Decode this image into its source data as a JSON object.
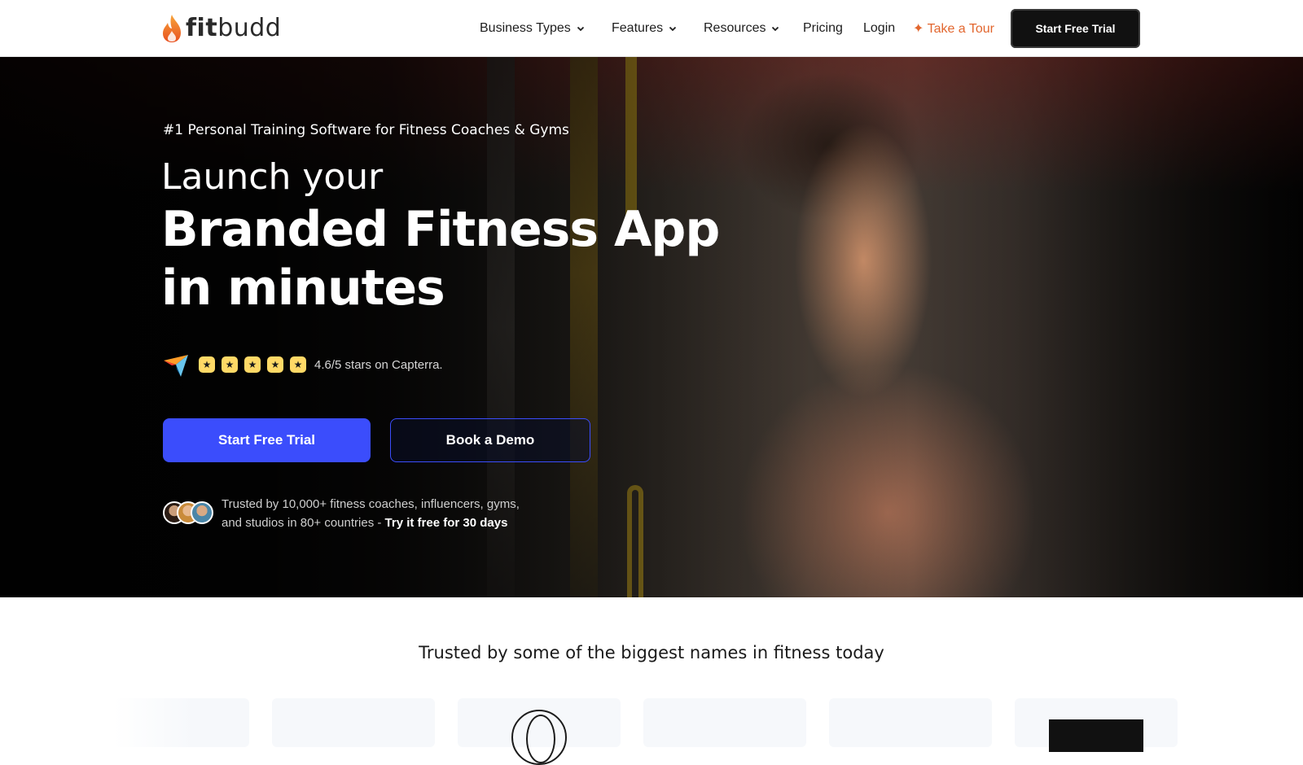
{
  "header": {
    "logo_part1": "fit",
    "logo_part2": "budd",
    "nav": [
      {
        "label": "Business Types",
        "has_dropdown": true
      },
      {
        "label": "Features",
        "has_dropdown": true
      },
      {
        "label": "Resources",
        "has_dropdown": true
      },
      {
        "label": "Pricing",
        "has_dropdown": false
      },
      {
        "label": "Login",
        "has_dropdown": false
      }
    ],
    "tour_label": "✦ Take a Tour",
    "cta_label": "Start Free Trial"
  },
  "hero": {
    "eyebrow": "#1 Personal Training Software for Fitness Coaches & Gyms",
    "headline_line1": "Launch your",
    "headline_line2": "Branded Fitness App",
    "headline_line3": "in minutes",
    "rating": {
      "stars": 5,
      "text": "4.6/5 stars on Capterra."
    },
    "primary_button": "Start Free Trial",
    "secondary_button": "Book a Demo",
    "trust_text": "Trusted by 10,000+ fitness coaches, influencers, gyms,",
    "trust_text_line2": "and studios in 80+ countries -",
    "trust_highlight": "Try it free for 30 days"
  },
  "trusted_section": {
    "title": "Trusted by some of the biggest names in fitness today"
  },
  "colors": {
    "accent_blue": "#3b4dfc",
    "tour_orange": "#e2662e",
    "star_yellow": "#ffd966",
    "header_cta_bg": "#111111"
  },
  "icons": {
    "logo": "flame-icon",
    "capterra": "capterra-icon",
    "dropdown": "chevron-down-icon",
    "star": "star-icon"
  }
}
